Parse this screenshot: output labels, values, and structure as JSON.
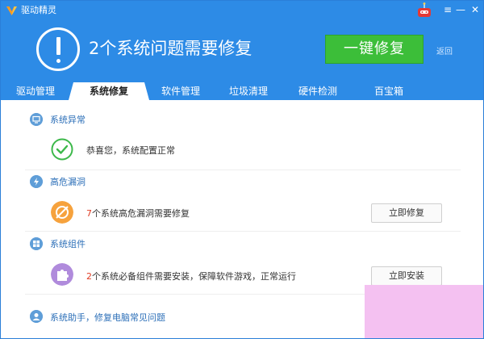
{
  "app": {
    "title": "驱动精灵"
  },
  "header": {
    "headline": "2个系统问题需要修复",
    "fix_button": "一键修复",
    "back": "返回"
  },
  "window_controls": {
    "menu": "≡",
    "minimize": "—",
    "close": "✕"
  },
  "tabs": [
    {
      "label": "驱动管理"
    },
    {
      "label": "系统修复",
      "active": true
    },
    {
      "label": "软件管理"
    },
    {
      "label": "垃圾清理"
    },
    {
      "label": "硬件检测"
    },
    {
      "label": "百宝箱"
    }
  ],
  "sections": {
    "system_abnormal": {
      "title": "系统异常",
      "status_text": "恭喜您，系统配置正常"
    },
    "high_risk": {
      "title": "高危漏洞",
      "count": "7",
      "text": "个系统高危漏洞需要修复",
      "button": "立即修复"
    },
    "components": {
      "title": "系统组件",
      "count": "2",
      "text": "个系统必备组件需要安装，保障软件游戏，正常运行",
      "button": "立即安装"
    },
    "assistant": {
      "title": "系统助手，修复电脑常见问题"
    }
  },
  "colors": {
    "header_bg": "#2d8be6",
    "fix_button_bg": "#3cbe39",
    "section_title": "#2c6fb8",
    "red_number": "#e03d25"
  }
}
